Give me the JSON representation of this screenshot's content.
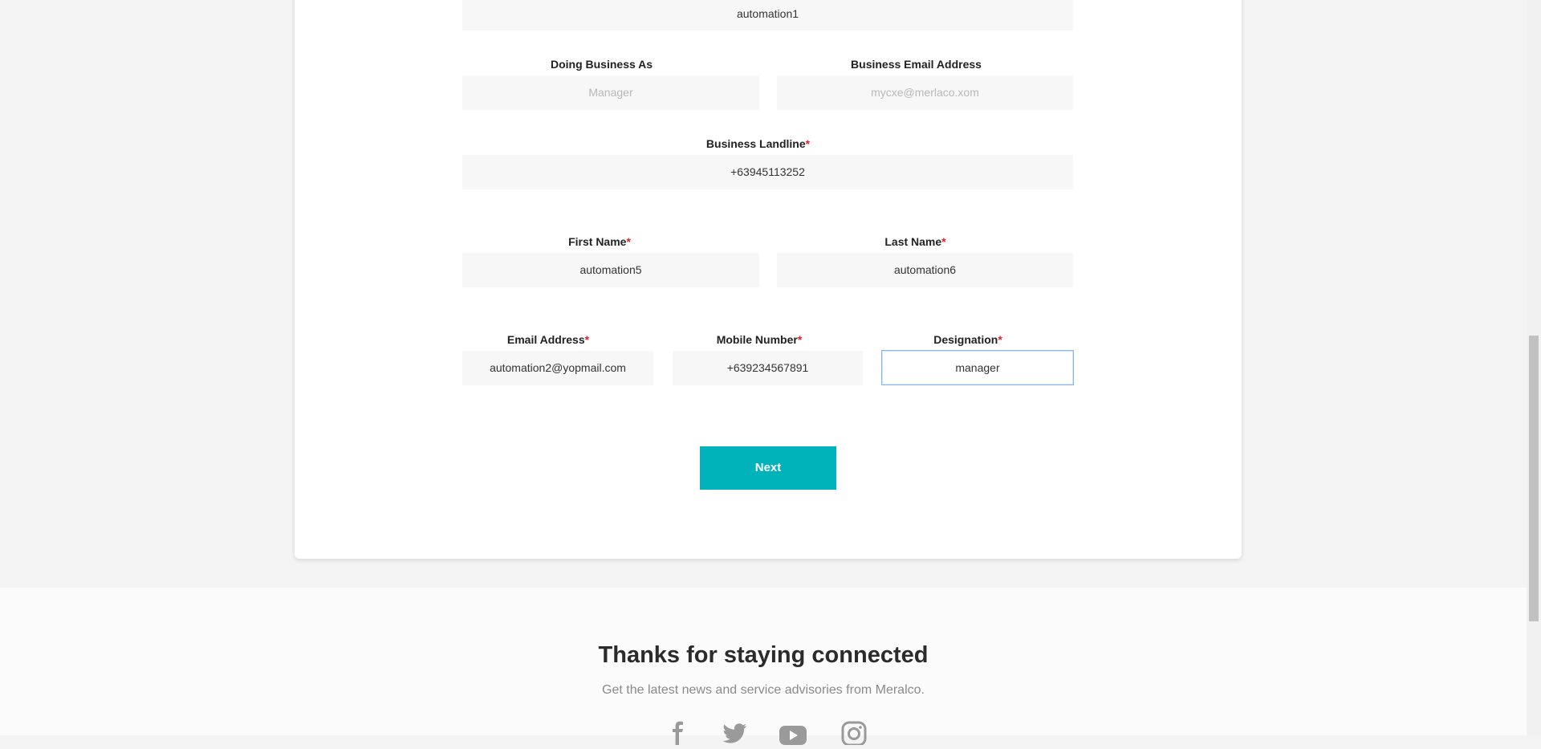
{
  "form": {
    "business_name_value": "automation1",
    "doing_business_as": {
      "label": "Doing Business As",
      "placeholder": "Manager"
    },
    "business_email": {
      "label": "Business Email Address",
      "placeholder": "mycxe@merlaco.xom"
    },
    "business_landline": {
      "label": "Business Landline",
      "required_mark": "*",
      "value": "+63945113252"
    },
    "first_name": {
      "label": "First Name",
      "required_mark": "*",
      "value": "automation5"
    },
    "last_name": {
      "label": "Last Name",
      "required_mark": "*",
      "value": "automation6"
    },
    "email_address": {
      "label": "Email Address",
      "required_mark": "*",
      "value": "automation2@yopmail.com"
    },
    "mobile_number": {
      "label": "Mobile Number",
      "required_mark": "*",
      "value": "+639234567891"
    },
    "designation": {
      "label": "Designation",
      "required_mark": "*",
      "value": "manager"
    },
    "next_label": "Next"
  },
  "footer": {
    "title": "Thanks for staying connected",
    "subtitle": "Get the latest news and service advisories from Meralco.",
    "social_icons": [
      "facebook-icon",
      "twitter-icon",
      "youtube-icon",
      "instagram-icon"
    ]
  },
  "colors": {
    "accent": "#00b3bb",
    "required": "#e0202b",
    "focus_border": "#86b7e8"
  }
}
